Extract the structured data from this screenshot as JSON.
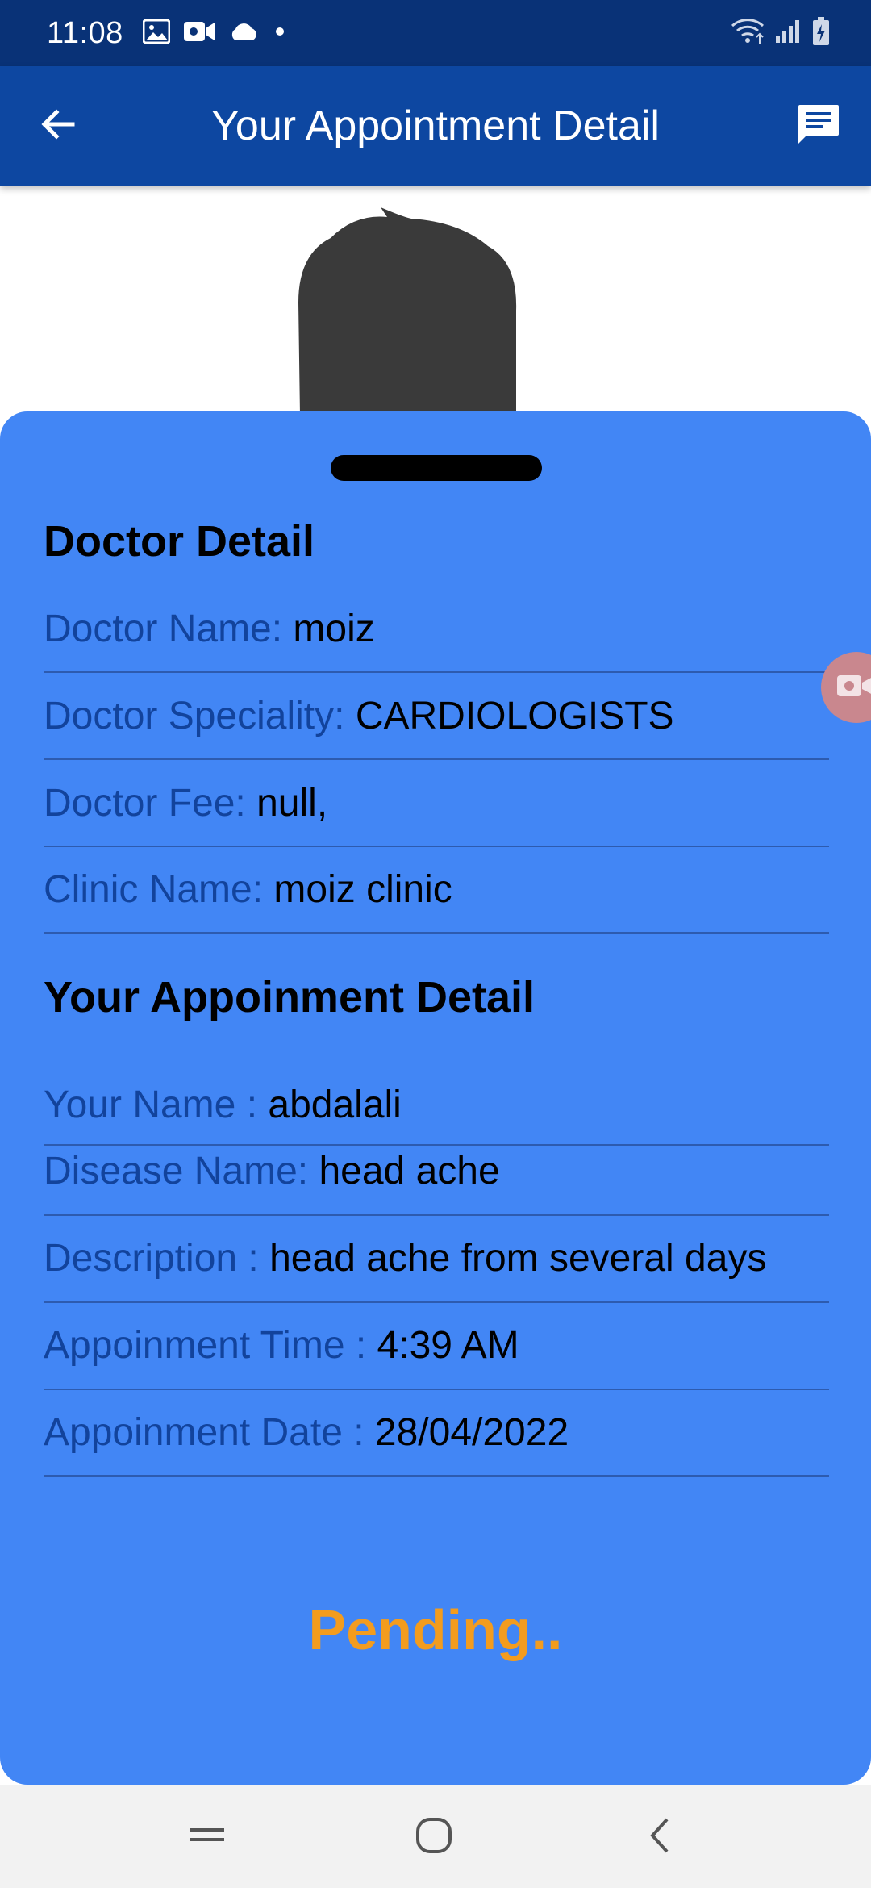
{
  "status_bar": {
    "time": "11:08",
    "left_icons": [
      "image-icon",
      "video-icon",
      "cloud-icon",
      "dot-icon"
    ],
    "right_icons": [
      "wifi-icon",
      "signal-icon",
      "battery-charging-icon"
    ]
  },
  "app_bar": {
    "title": "Your Appointment Detail",
    "back_icon": "arrow-left-icon",
    "action_icon": "message-icon",
    "color": "#0d47a1"
  },
  "sheet": {
    "color": "#4286f5",
    "doctor_section": {
      "title": "Doctor Detail",
      "rows": [
        {
          "label": "Doctor Name: ",
          "value": "moiz"
        },
        {
          "label": "Doctor Speciality: ",
          "value": "CARDIOLOGISTS"
        },
        {
          "label": "Doctor Fee: ",
          "value": "null,"
        },
        {
          "label": "Clinic Name: ",
          "value": "moiz clinic"
        }
      ]
    },
    "appointment_section": {
      "title": "Your Appoinment Detail",
      "rows": [
        {
          "label": "Your Name : ",
          "value": "abdalali"
        },
        {
          "label": "Disease Name: ",
          "value": "head ache"
        },
        {
          "label": "Description : ",
          "value": "head ache from several days"
        },
        {
          "label": "Appoinment Time : ",
          "value": "4:39 AM"
        },
        {
          "label": "Appoinment Date : ",
          "value": "28/04/2022"
        }
      ]
    },
    "status": "Pending..",
    "status_color": "#f39c1e"
  },
  "nav_bar": {
    "icons": [
      "recent-apps-icon",
      "home-icon",
      "back-icon"
    ]
  }
}
